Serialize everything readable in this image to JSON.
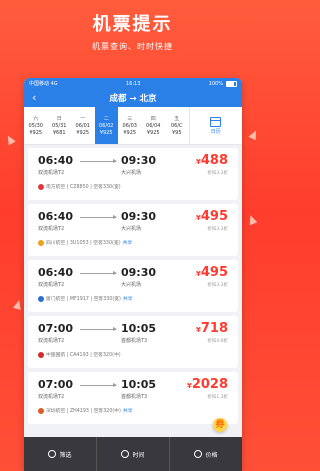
{
  "promo": {
    "title": "机票提示",
    "subtitle": "机票查询、时时快捷"
  },
  "status_bar": {
    "carrier": "中国移动",
    "network": "4G",
    "time": "16:13",
    "battery": "100%"
  },
  "nav": {
    "back_icon": "chevron-left-icon",
    "title": "成都 → 北京"
  },
  "date_strip": {
    "days": [
      {
        "weekday": "六",
        "date": "05/30",
        "price": "¥925"
      },
      {
        "weekday": "日",
        "date": "05/31",
        "price": "¥681"
      },
      {
        "weekday": "一",
        "date": "06/01",
        "price": "¥925"
      },
      {
        "weekday": "二",
        "date": "06/02",
        "price": "¥925",
        "active": true
      },
      {
        "weekday": "三",
        "date": "06/03",
        "price": "¥925"
      },
      {
        "weekday": "四",
        "date": "06/04",
        "price": "¥925"
      },
      {
        "weekday": "五",
        "date": "06/C",
        "price": "¥95"
      }
    ],
    "calendar_label": "日历"
  },
  "flights": [
    {
      "dep_time": "06:40",
      "arr_time": "09:30",
      "dep_airport": "双流机场T2",
      "arr_airport": "大兴机场",
      "price": "488",
      "currency": "¥",
      "discount": "折扣3.2折",
      "airline_info": "南方航空 | CZ8850 | 空客330(宽)",
      "share": "",
      "airline_color": "#e03a3a"
    },
    {
      "dep_time": "06:40",
      "arr_time": "09:30",
      "dep_airport": "双流机场T2",
      "arr_airport": "大兴机场",
      "price": "495",
      "currency": "¥",
      "discount": "折扣3.2折",
      "airline_info": "四川航空 | 3U1053 | 空客330(宽)",
      "share": "共享",
      "airline_color": "#e8a317"
    },
    {
      "dep_time": "06:40",
      "arr_time": "09:30",
      "dep_airport": "双流机场T2",
      "arr_airport": "大兴机场",
      "price": "495",
      "currency": "¥",
      "discount": "折扣3.2折",
      "airline_info": "厦门航空 | MF1917 | 空客330(宽)",
      "share": "共享",
      "airline_color": "#2a6fd6"
    },
    {
      "dep_time": "07:00",
      "arr_time": "10:05",
      "dep_airport": "双流机场T2",
      "arr_airport": "首都机场T3",
      "price": "718",
      "currency": "¥",
      "discount": "折扣4.6折",
      "airline_info": "中国国航 | CA4193 | 空客320(中)",
      "share": "",
      "airline_color": "#d42a2a"
    },
    {
      "dep_time": "07:00",
      "arr_time": "10:05",
      "dep_airport": "双流机场T2",
      "arr_airport": "首都机场T3",
      "price": "2028",
      "currency": "¥",
      "discount": "折扣1.3折",
      "airline_info": "深圳航空 | ZH4193 | 空客320(中)",
      "share": "共享",
      "airline_color": "#e05a2a"
    }
  ],
  "toolbar": {
    "filter_label": "筛选",
    "time_label": "时间",
    "price_label": "价格"
  },
  "fab_label": "券"
}
